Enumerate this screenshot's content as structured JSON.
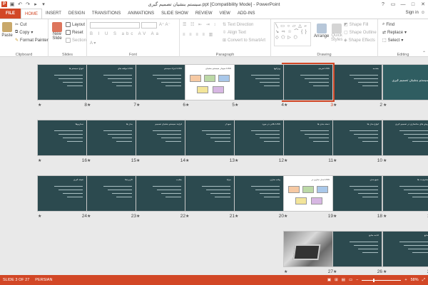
{
  "titlebar": {
    "title": "سیستم بنشیان تصمیم گیری.ppt [Compatibility Mode] - PowerPoint",
    "logo": "P",
    "qat_icons": [
      "save-icon",
      "undo-icon",
      "redo-icon",
      "start-from-beginning-icon",
      "customize-qat-icon"
    ],
    "controls": [
      "?",
      "▭",
      "—",
      "□",
      "✕"
    ]
  },
  "tabs": [
    {
      "label": "FILE",
      "kind": "file"
    },
    {
      "label": "HOME",
      "kind": "active"
    },
    {
      "label": "INSERT"
    },
    {
      "label": "DESIGN"
    },
    {
      "label": "TRANSITIONS"
    },
    {
      "label": "ANIMATIONS"
    },
    {
      "label": "SLIDE SHOW"
    },
    {
      "label": "REVIEW"
    },
    {
      "label": "VIEW"
    },
    {
      "label": "ADD-INS"
    }
  ],
  "signin": "Sign in",
  "ribbon": {
    "clipboard": {
      "label": "Clipboard",
      "paste": "Paste",
      "cut": "Cut",
      "copy": "Copy",
      "format_painter": "Format Painter"
    },
    "slides": {
      "label": "Slides",
      "new_slide": "New",
      "new_slide_2": "Slide",
      "layout": "Layout",
      "reset": "Reset",
      "section": "Section"
    },
    "font": {
      "label": "Font",
      "font_name": "",
      "font_size": ""
    },
    "paragraph": {
      "label": "Paragraph",
      "text_direction": "Text Direction",
      "align_text": "Align Text",
      "convert": "Convert to SmartArt"
    },
    "drawing": {
      "label": "Drawing",
      "arrange": "Arrange",
      "quick_styles": "Quick",
      "quick_styles_2": "Styles",
      "shape_fill": "Shape Fill",
      "shape_outline": "Shape Outline",
      "shape_effects": "Shape Effects"
    },
    "editing": {
      "label": "Editing",
      "find": "Find",
      "replace": "Replace",
      "select": "Select"
    }
  },
  "slides": [
    {
      "num": "1",
      "title": "سیستم بنشیان تصمیم گیری",
      "kind": "title"
    },
    {
      "num": "2",
      "title": "مقدمه",
      "kind": "text"
    },
    {
      "num": "3",
      "title": "تعریف DSS",
      "kind": "text",
      "selected": true
    },
    {
      "num": "4",
      "title": "ویژگیها",
      "kind": "text"
    },
    {
      "num": "5",
      "title": "نمودار سیستم بنشیان DSS",
      "kind": "diagram"
    },
    {
      "num": "6",
      "title": "اجزاء سیستم DSS",
      "kind": "text"
    },
    {
      "num": "7",
      "title": "مؤلفه های DSS",
      "kind": "text"
    },
    {
      "num": "8",
      "title": "انواع سیستم ها",
      "kind": "text"
    },
    {
      "num": "9",
      "title": "روش های مدلسازی در تصمیم گیری",
      "kind": "text"
    },
    {
      "num": "10",
      "title": "انواع مدل ها",
      "kind": "text"
    },
    {
      "num": "11",
      "title": "دسته بندی ها",
      "kind": "text"
    },
    {
      "num": "12",
      "title": "نکاتی در مورد DSS",
      "kind": "text"
    },
    {
      "num": "13",
      "title": "نمودار",
      "kind": "text"
    },
    {
      "num": "14",
      "title": "فرآیند سیستم بنشیان تصمیم",
      "kind": "text"
    },
    {
      "num": "15",
      "title": "مدل ها",
      "kind": "text"
    },
    {
      "num": "16",
      "title": "سناریوها",
      "kind": "text"
    },
    {
      "num": "17",
      "title": "محدودیت ها",
      "kind": "text"
    },
    {
      "num": "18",
      "title": "جمع بندی",
      "kind": "text"
    },
    {
      "num": "19",
      "title": "مدل سازی در DSS",
      "kind": "diagram"
    },
    {
      "num": "20",
      "title": "پیاده سازی",
      "kind": "text"
    },
    {
      "num": "21",
      "title": "مزایا",
      "kind": "text"
    },
    {
      "num": "22",
      "title": "معایب",
      "kind": "text"
    },
    {
      "num": "23",
      "title": "کاربردها",
      "kind": "text"
    },
    {
      "num": "24",
      "title": "نتیجه گیری",
      "kind": "text"
    },
    {
      "num": "25",
      "title": "منابع",
      "kind": "text"
    },
    {
      "num": "26",
      "title": "ادامه منابع",
      "kind": "text"
    },
    {
      "num": "27",
      "title": "",
      "kind": "photo"
    }
  ],
  "star": "★",
  "status": {
    "slide": "SLIDE 3 OF 27",
    "language": "PERSIAN",
    "zoom": "58%",
    "zoom_fraction": 0.58
  },
  "colors": {
    "accent": "#d24726",
    "slide_bg": "#2c4a4f"
  }
}
